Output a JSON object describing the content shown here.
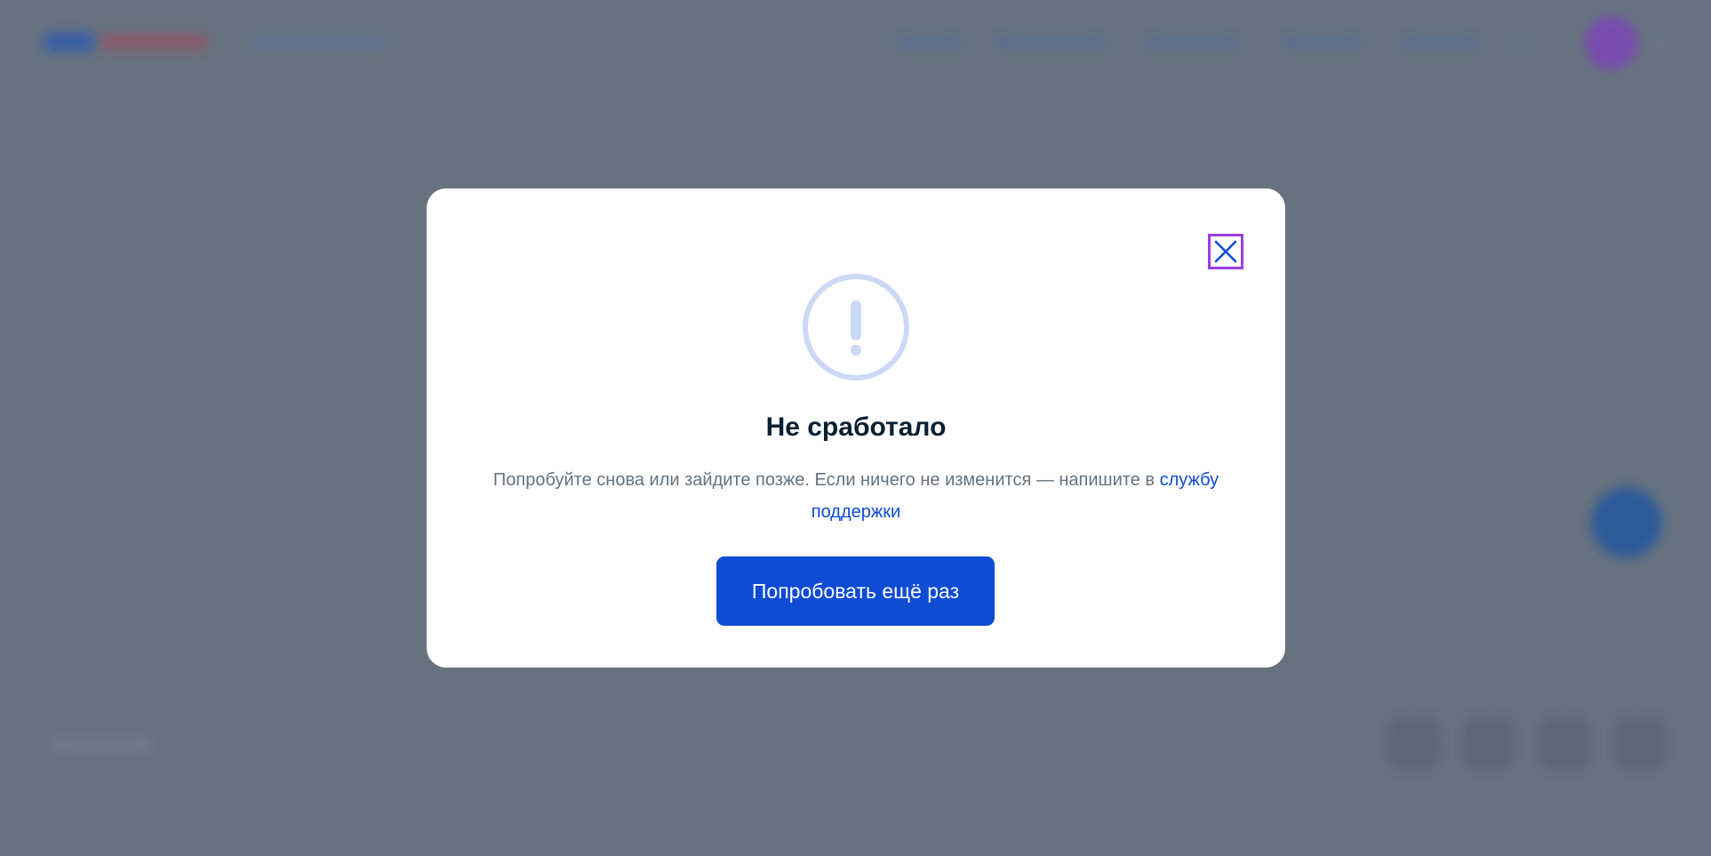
{
  "modal": {
    "title": "Не сработало",
    "description": "Попробуйте снова или зайдите позже. Если ничего не изменится — напишите в ",
    "support_link": "службу поддержки",
    "retry_button": "Попробовать ещё раз",
    "close_icon": "close-icon",
    "warning_icon": "exclamation-circle-icon"
  },
  "colors": {
    "overlay": "#66727f",
    "accent": "#0d4cd3",
    "title": "#0b1f33",
    "text": "#66727f",
    "icon_light": "#cdd8f6",
    "focus_outline": "#9b3fe0"
  }
}
